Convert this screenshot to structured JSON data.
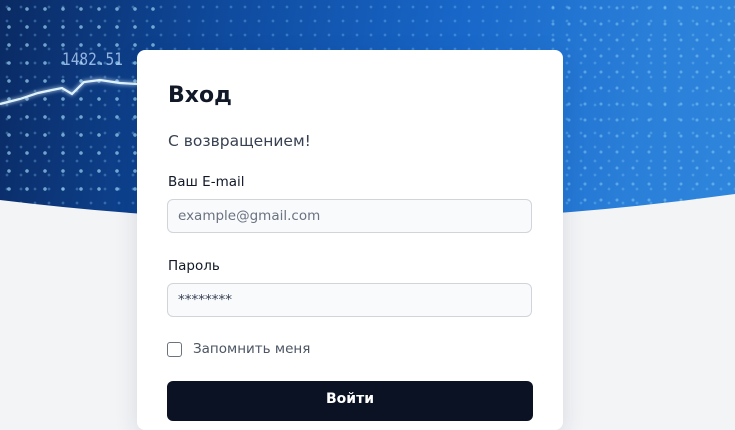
{
  "background": {
    "ticker_value": "1482.51"
  },
  "login_card": {
    "title": "Вход",
    "subtitle": "С возвращением!",
    "email": {
      "label": "Ваш E-mail",
      "placeholder": "example@gmail.com",
      "value": ""
    },
    "password": {
      "label": "Пароль",
      "value": "********"
    },
    "remember_me": {
      "label": "Запомнить меня",
      "checked": false
    },
    "submit_label": "Войти"
  },
  "colors": {
    "primary_button": "#0b1224",
    "hero_blue": "#1867c9",
    "page_background": "#f3f4f6"
  }
}
